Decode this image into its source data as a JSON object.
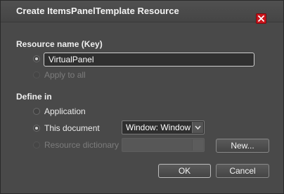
{
  "window": {
    "title": "Create ItemsPanelTemplate Resource",
    "close_icon": "close-icon",
    "close_color": "#c8141b"
  },
  "resource_name": {
    "heading": "Resource name (Key)",
    "key_value": "VirtualPanel",
    "apply_to_all_label": "Apply to all"
  },
  "define_in": {
    "heading": "Define in",
    "application_label": "Application",
    "this_document_label": "This document",
    "document_select_value": "Window: Window",
    "resource_dictionary_label": "Resource dictionary",
    "resource_dictionary_value": "",
    "new_button_label": "New..."
  },
  "buttons": {
    "ok_label": "OK",
    "cancel_label": "Cancel"
  }
}
